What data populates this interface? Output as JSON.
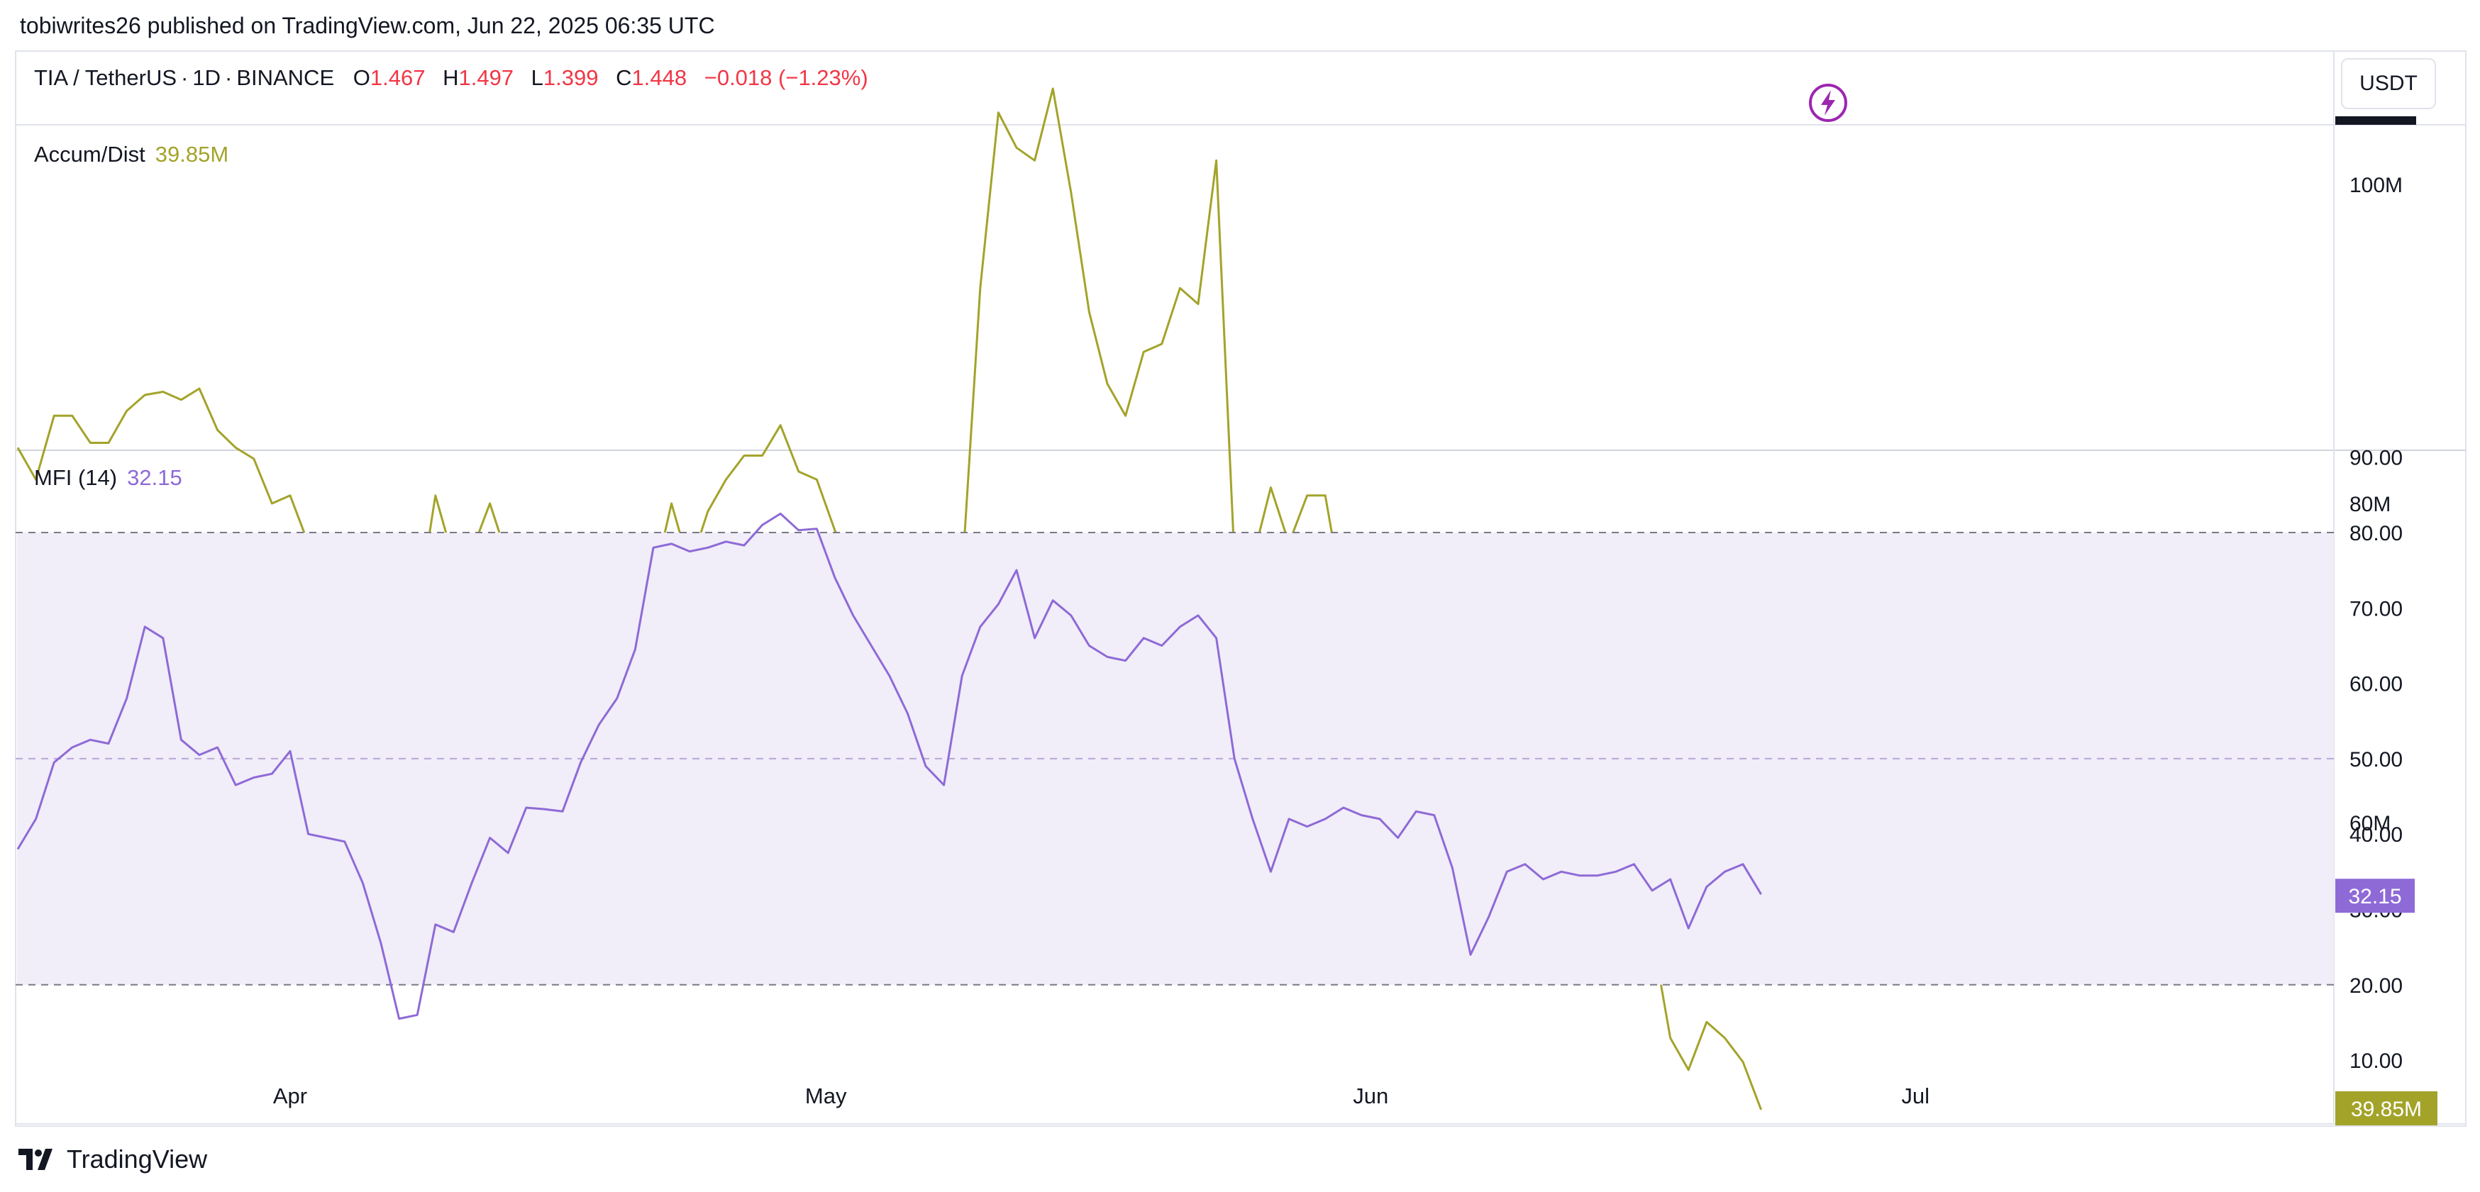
{
  "attribution": "tobiwrites26 published on TradingView.com, Jun 22, 2025 06:35 UTC",
  "symbol": {
    "name": "TIA / TetherUS",
    "interval": "1D",
    "exchange": "BINANCE",
    "open_label": "O",
    "open": "1.467",
    "high_label": "H",
    "high": "1.497",
    "low_label": "L",
    "low": "1.399",
    "close_label": "C",
    "close": "1.448",
    "change": "−0.018 (−1.23%)"
  },
  "currency_button": "USDT",
  "brand": "TradingView",
  "colors": {
    "ad_line": "#a3a32a",
    "mfi_line": "#8e6ad6",
    "mfi_band": "#f1edf9",
    "negative": "#f23645"
  },
  "icons": [
    "lightning-icon",
    "tradingview-logo-icon"
  ],
  "chart_data": [
    {
      "type": "line",
      "indicator": "Accum/Dist",
      "label": "Accum/Dist",
      "current_value": "39.85M",
      "tick_labels": [
        "100M",
        "80M",
        "60M"
      ],
      "ylim": [
        33,
        113
      ],
      "x": [
        0,
        1,
        2,
        3,
        4,
        5,
        6,
        7,
        8,
        9,
        10,
        11,
        12,
        13,
        14,
        15,
        16,
        17,
        18,
        19,
        20,
        21,
        22,
        23,
        24,
        25,
        26,
        27,
        28,
        29,
        30,
        31,
        32,
        33,
        34,
        35,
        36,
        37,
        38,
        39,
        40,
        41,
        42,
        43,
        44,
        45,
        46,
        47,
        48,
        49,
        50,
        51,
        52,
        53,
        54,
        55,
        56,
        57,
        58,
        59,
        60,
        61,
        62,
        63,
        64,
        65,
        66,
        67,
        68,
        69,
        70,
        71,
        72,
        73,
        74,
        75,
        76,
        77,
        78,
        79,
        80,
        81,
        82,
        83,
        84,
        85,
        86,
        87,
        88,
        89,
        90,
        91,
        92,
        93,
        94,
        95,
        96
      ],
      "values": [
        83.5,
        81.5,
        85.5,
        85.5,
        83.8,
        83.8,
        85.8,
        86.8,
        87,
        86.5,
        87.2,
        84.6,
        83.5,
        82.8,
        80,
        80.5,
        77.5,
        78,
        77.5,
        76.8,
        72.5,
        77.5,
        73.2,
        80.5,
        76.5,
        77,
        80,
        76.5,
        75.5,
        72.5,
        69.5,
        71.5,
        71.8,
        74.5,
        76,
        75,
        80,
        76,
        79.5,
        81.5,
        83,
        83,
        84.9,
        82,
        81.5,
        78.3,
        75.5,
        75,
        73.5,
        72,
        74,
        76,
        75.5,
        93.5,
        104.5,
        102.3,
        101.5,
        106,
        99.5,
        92,
        87.5,
        85.5,
        89.5,
        90,
        93.5,
        92.5,
        101.5,
        76.5,
        76.5,
        81,
        77.5,
        80.5,
        80.5,
        74,
        62,
        66.5,
        68,
        71,
        70,
        67.5,
        60,
        56.5,
        59.5,
        57.5,
        64.5,
        73.5,
        67,
        56.6,
        53,
        52.7,
        53,
        46.5,
        44.5,
        47.5,
        46.5,
        45,
        42
      ]
    },
    {
      "type": "line",
      "indicator": "MFI",
      "label": "MFI (14)",
      "current_value": "32.15",
      "tick_labels": [
        "90.00",
        "80.00",
        "70.00",
        "60.00",
        "50.00",
        "40.00",
        "30.00",
        "20.00",
        "10.00"
      ],
      "band": [
        20,
        80
      ],
      "midline": 50,
      "ylim": [
        5,
        90
      ],
      "x_tick_labels": [
        {
          "label": "Apr",
          "x": 15
        },
        {
          "label": "May",
          "x": 44.5
        },
        {
          "label": "Jun",
          "x": 74.5
        },
        {
          "label": "Jul",
          "x": 104.5
        }
      ],
      "x": [
        0,
        1,
        2,
        3,
        4,
        5,
        6,
        7,
        8,
        9,
        10,
        11,
        12,
        13,
        14,
        15,
        16,
        17,
        18,
        19,
        20,
        21,
        22,
        23,
        24,
        25,
        26,
        27,
        28,
        29,
        30,
        31,
        32,
        33,
        34,
        35,
        36,
        37,
        38,
        39,
        40,
        41,
        42,
        43,
        44,
        45,
        46,
        47,
        48,
        49,
        50,
        51,
        52,
        53,
        54,
        55,
        56,
        57,
        58,
        59,
        60,
        61,
        62,
        63,
        64,
        65,
        66,
        67,
        68,
        69,
        70,
        71,
        72,
        73,
        74,
        75,
        76,
        77,
        78,
        79,
        80,
        81,
        82,
        83,
        84,
        85,
        86,
        87,
        88,
        89,
        90,
        91,
        92,
        93,
        94,
        95,
        96
      ],
      "values": [
        38,
        42,
        49.5,
        51.5,
        52.5,
        52,
        58,
        67.5,
        66,
        52.5,
        50.5,
        51.5,
        46.5,
        47.5,
        48,
        51,
        40,
        39.5,
        39,
        33.5,
        25.5,
        15.5,
        16,
        28,
        27,
        33.5,
        39.5,
        37.5,
        43.5,
        43.3,
        43,
        49.5,
        54.5,
        58,
        64.5,
        78,
        78.5,
        77.5,
        78,
        78.8,
        78.3,
        81,
        82.5,
        80.3,
        80.5,
        74,
        69,
        65,
        61,
        56,
        49,
        46.5,
        61,
        67.5,
        70.5,
        75,
        66,
        71,
        69,
        65,
        63.5,
        63,
        66,
        65,
        67.5,
        69,
        66,
        50,
        42,
        35,
        42,
        41,
        42,
        43.5,
        42.5,
        42,
        39.5,
        43,
        42.5,
        35.5,
        24,
        29,
        35,
        36,
        34,
        35,
        34.5,
        34.5,
        35,
        36,
        32.5,
        34,
        27.5,
        33,
        35,
        36,
        32
      ]
    }
  ]
}
